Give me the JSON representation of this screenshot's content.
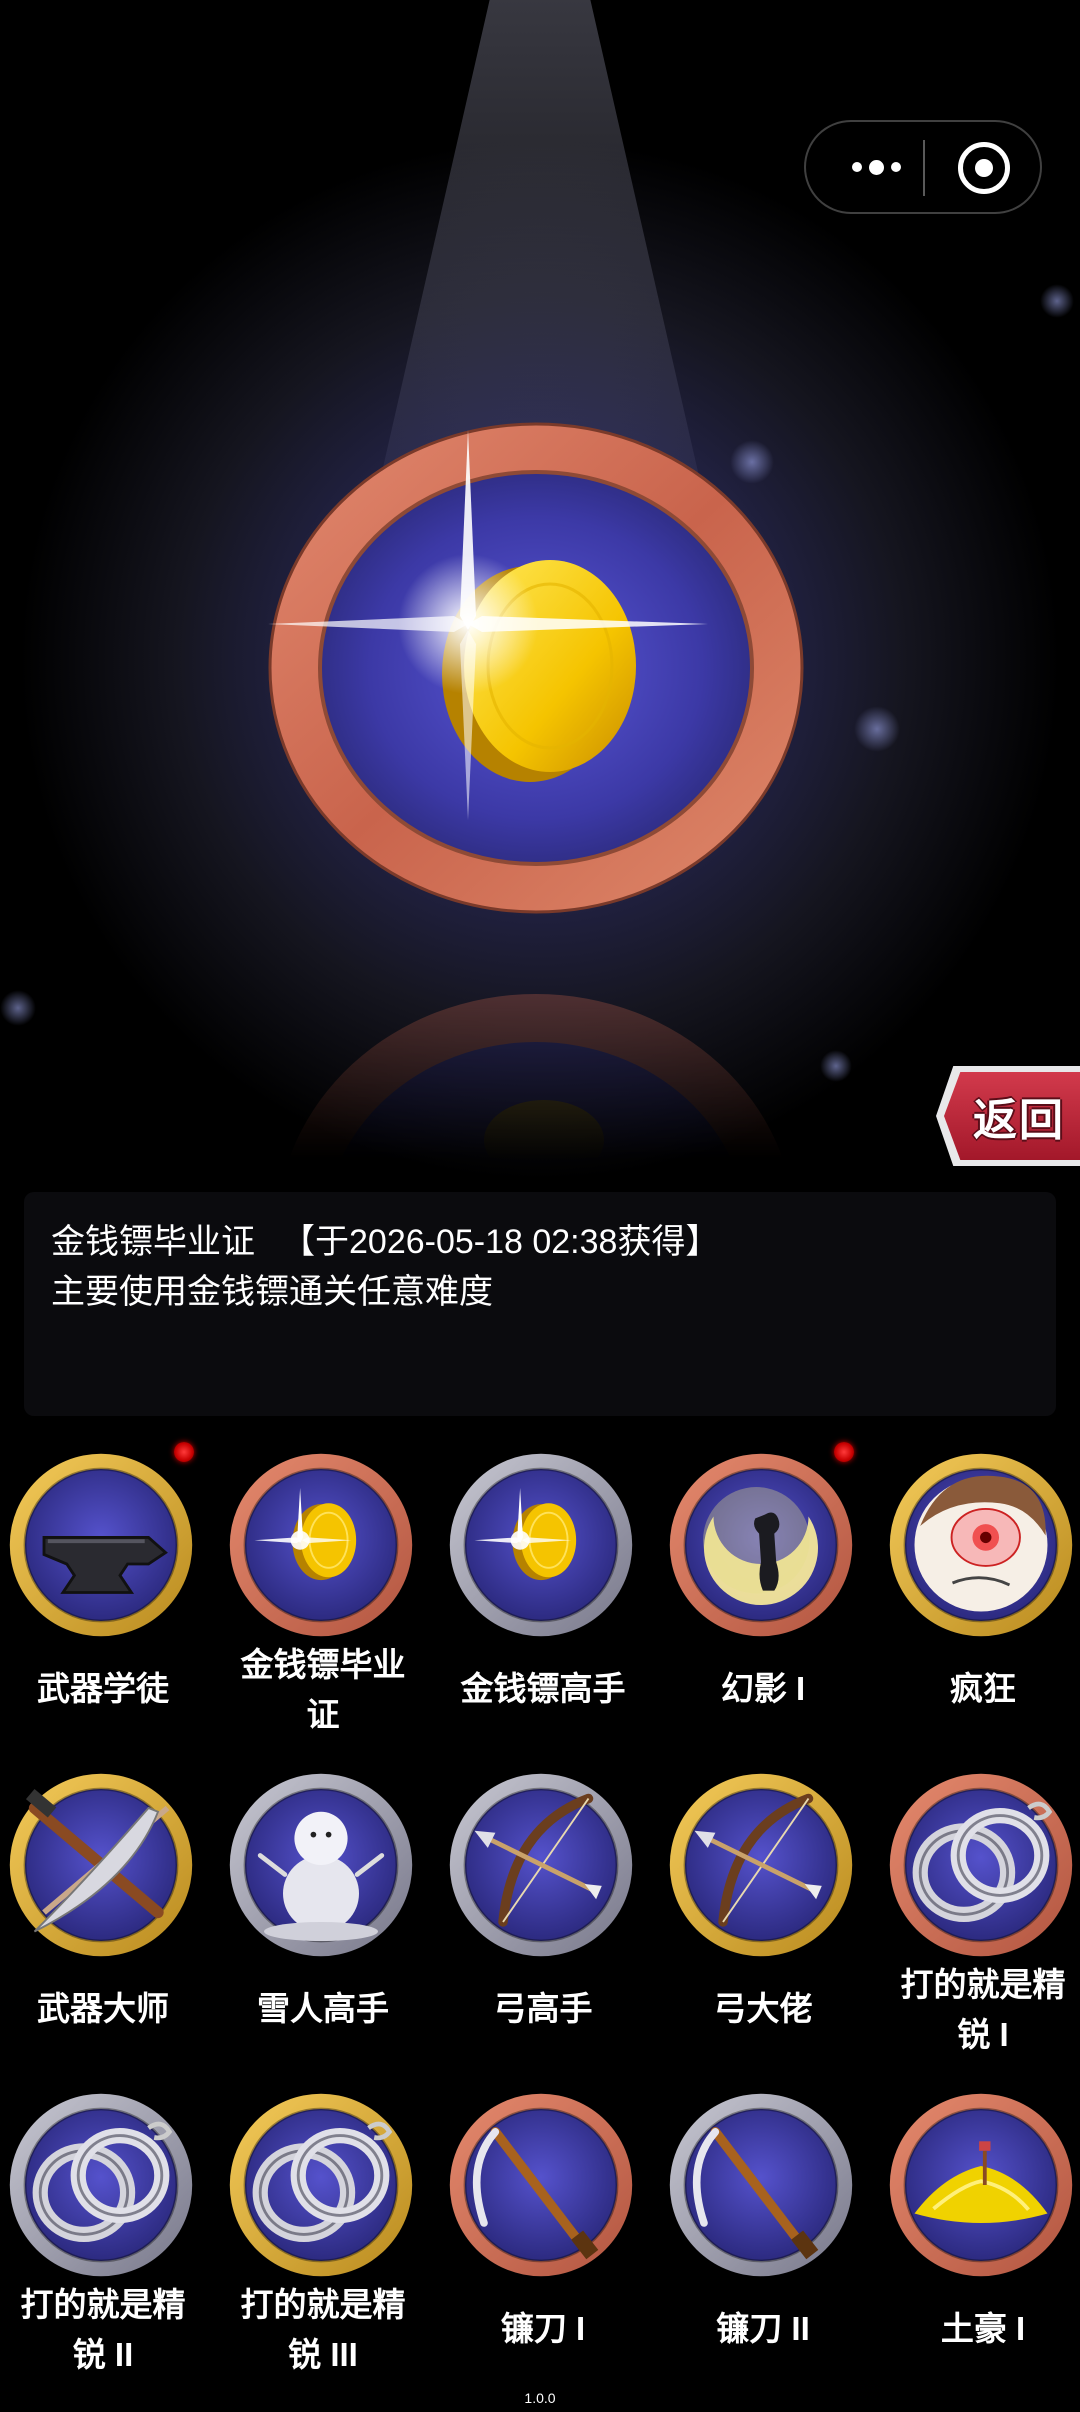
{
  "capsule": {
    "more_icon": "more-dots-icon",
    "close_icon": "target-circle-icon"
  },
  "featured": {
    "name": "金钱镖毕业证",
    "obtained_text": "【于2026-05-18 02:38获得】",
    "description": "主要使用金钱镖通关任意难度"
  },
  "back_label": "返回",
  "colors": {
    "ring_copper": "#d9735b",
    "ring_gold": "#d9a53a",
    "ring_silver": "#9a9aa8",
    "medal_face": "#3d3a9e",
    "new_dot": "#e02020",
    "back_red": "#c42a3c"
  },
  "achievements": [
    {
      "name_lines": [
        "武器学徒"
      ],
      "ring": "gold",
      "icon": "anvil-icon",
      "new": true
    },
    {
      "name_lines": [
        "金钱镖毕业",
        "证"
      ],
      "ring": "copper",
      "icon": "coin-icon",
      "new": false
    },
    {
      "name_lines": [
        "金钱镖高手"
      ],
      "ring": "silver",
      "icon": "coin-icon",
      "new": false
    },
    {
      "name_lines": [
        "幻影 I"
      ],
      "ring": "copper",
      "icon": "moon-silhouette-icon",
      "new": true
    },
    {
      "name_lines": [
        "疯狂"
      ],
      "ring": "gold",
      "icon": "crazy-face-icon",
      "new": false
    },
    {
      "name_lines": [
        "武器大师"
      ],
      "ring": "gold",
      "icon": "crossed-weapons-icon",
      "new": false
    },
    {
      "name_lines": [
        "雪人高手"
      ],
      "ring": "silver",
      "icon": "snowman-icon",
      "new": false
    },
    {
      "name_lines": [
        "弓高手"
      ],
      "ring": "silver",
      "icon": "bow-icon",
      "new": false
    },
    {
      "name_lines": [
        "弓大佬"
      ],
      "ring": "gold",
      "icon": "bow-icon",
      "new": false
    },
    {
      "name_lines": [
        "打的就是精",
        "锐 I"
      ],
      "ring": "copper",
      "icon": "handcuffs-icon",
      "new": false
    },
    {
      "name_lines": [
        "打的就是精",
        "锐 II"
      ],
      "ring": "silver",
      "icon": "handcuffs-icon",
      "new": false
    },
    {
      "name_lines": [
        "打的就是精",
        "锐 III"
      ],
      "ring": "gold",
      "icon": "handcuffs-icon",
      "new": false
    },
    {
      "name_lines": [
        "镰刀 I"
      ],
      "ring": "copper",
      "icon": "scythe-icon",
      "new": false
    },
    {
      "name_lines": [
        "镰刀 II"
      ],
      "ring": "silver",
      "icon": "scythe-icon",
      "new": false
    },
    {
      "name_lines": [
        "土豪 I"
      ],
      "ring": "copper",
      "icon": "gold-pile-icon",
      "new": false
    }
  ],
  "version": "1.0.0"
}
